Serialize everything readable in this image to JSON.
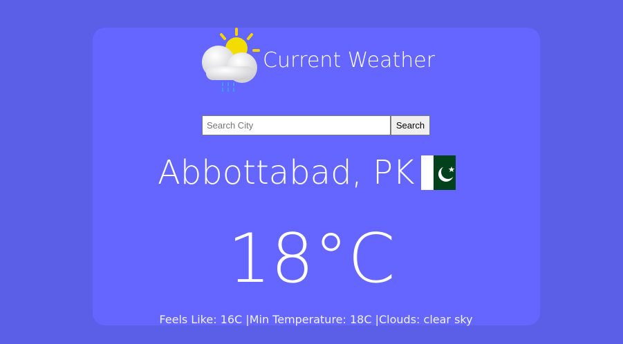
{
  "header": {
    "title": "Current Weather",
    "icon": "sun-cloud-rain-icon"
  },
  "search": {
    "placeholder": "Search City",
    "value": "",
    "button_label": "Search"
  },
  "location": {
    "city": "Abbottabad, PK",
    "flag_icon": "pakistan-flag-icon"
  },
  "weather": {
    "temperature": "18°C",
    "details": "Feels Like: 16C |Min Temperature: 18C |Clouds: clear sky"
  },
  "colors": {
    "page_background": "#5b5fe8",
    "card_background": "#6466ff",
    "text": "#ffffff",
    "flag_green": "#01411c"
  }
}
